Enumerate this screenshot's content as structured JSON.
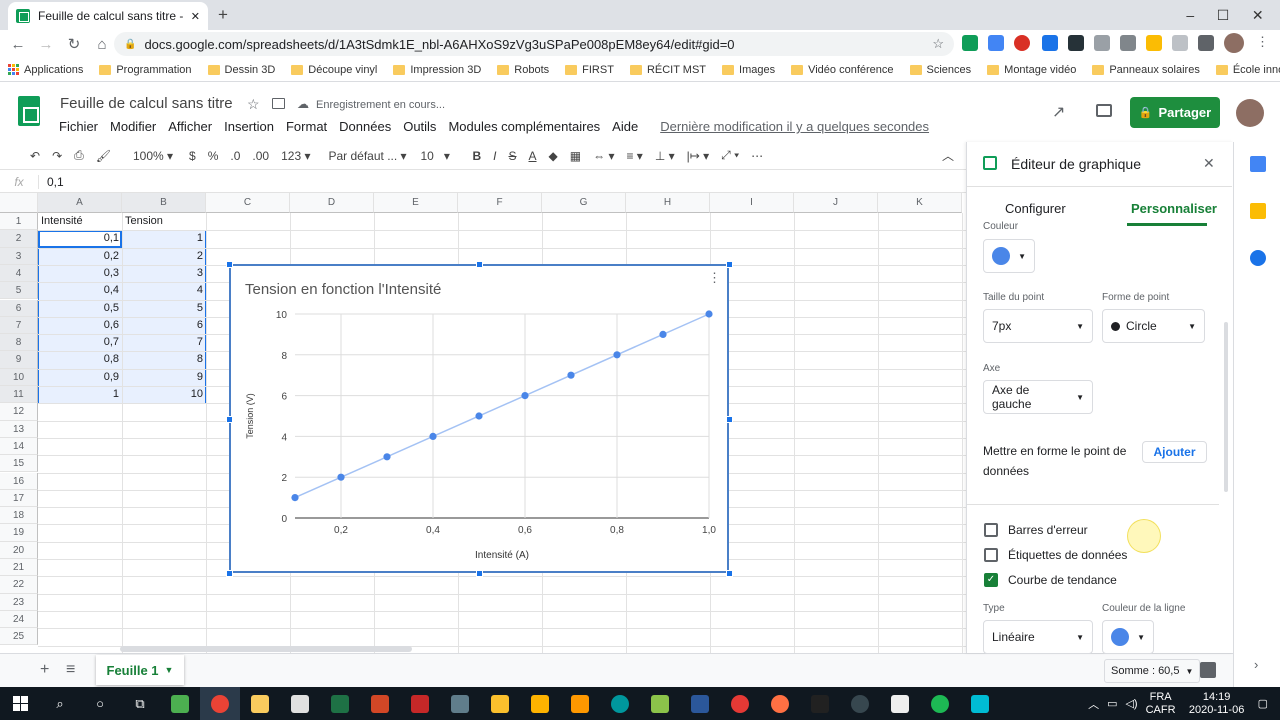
{
  "browser": {
    "tab_title": "Feuille de calcul sans titre - Goog",
    "tab_close": "✕",
    "new_tab": "+",
    "url": "docs.google.com/spreadsheets/d/1A3tSdmk1E_nbl-A6AHXoS9zVg3uSPaPe008pEM8ey64/edit#gid=0",
    "bookmarks": [
      "Applications",
      "Programmation",
      "Dessin 3D",
      "Découpe vinyl",
      "Impression 3D",
      "Robots",
      "FIRST",
      "RÉCIT MST",
      "Images",
      "Vidéo conférence",
      "Sciences",
      "Montage vidéo",
      "Panneaux solaires",
      "École innovante"
    ],
    "bookmarks_more": "»"
  },
  "sheets": {
    "doc_title": "Feuille de calcul sans titre",
    "save_status": "Enregistrement en cours...",
    "menu": [
      "Fichier",
      "Modifier",
      "Afficher",
      "Insertion",
      "Format",
      "Données",
      "Outils",
      "Modules complémentaires",
      "Aide"
    ],
    "last_edit": "Dernière modification il y a quelques secondes",
    "share_label": "Partager"
  },
  "toolbar": {
    "zoom": "100%",
    "currency": "$",
    "percent": "%",
    "dec_less": ".0",
    "dec_more": ".00",
    "format_more": "123",
    "font": "Par défaut ...",
    "size": "10",
    "more": "⋯"
  },
  "formula_bar": {
    "fx": "fx",
    "value": "0,1"
  },
  "grid": {
    "columns": [
      "A",
      "B",
      "C",
      "D",
      "E",
      "F",
      "G",
      "H",
      "I",
      "J",
      "K"
    ],
    "rows": [
      "1",
      "2",
      "3",
      "4",
      "5",
      "6",
      "7",
      "8",
      "9",
      "10",
      "11",
      "12",
      "13",
      "14",
      "15",
      "16",
      "17",
      "18",
      "19",
      "20",
      "21",
      "22",
      "23",
      "24",
      "25"
    ],
    "headers": [
      "Intensité",
      "Tension"
    ],
    "col_a": [
      "0,1",
      "0,2",
      "0,3",
      "0,4",
      "0,5",
      "0,6",
      "0,7",
      "0,8",
      "0,9",
      "1"
    ],
    "col_b": [
      "1",
      "2",
      "3",
      "4",
      "5",
      "6",
      "7",
      "8",
      "9",
      "10"
    ]
  },
  "chart_data": {
    "type": "scatter",
    "title": "Tension en fonction l'Intensité",
    "xlabel": "Intensité (A)",
    "ylabel": "Tension (V)",
    "x": [
      0.1,
      0.2,
      0.3,
      0.4,
      0.5,
      0.6,
      0.7,
      0.8,
      0.9,
      1.0
    ],
    "y": [
      1,
      2,
      3,
      4,
      5,
      6,
      7,
      8,
      9,
      10
    ],
    "xticks": [
      "0,2",
      "0,4",
      "0,6",
      "0,8",
      "1,0"
    ],
    "yticks": [
      "0",
      "2",
      "4",
      "6",
      "8",
      "10"
    ],
    "xlim": [
      0.1,
      1.0
    ],
    "ylim": [
      0,
      10
    ],
    "trendline": "linear",
    "color": "#4a86e8",
    "trend_color": "#a4c2f4",
    "grid": true
  },
  "bottom": {
    "add": "+",
    "list": "≡",
    "sheet_tab": "Feuille 1",
    "sum": "Somme : 60,5"
  },
  "panel": {
    "title": "Éditeur de graphique",
    "tab_config": "Configurer",
    "tab_custom": "Personnaliser",
    "couleur_label": "Couleur",
    "point_size_label": "Taille du point",
    "point_size": "7px",
    "point_shape_label": "Forme de point",
    "point_shape": "Circle",
    "axis_label": "Axe",
    "axis": "Axe de gauche",
    "format_point": "Mettre en forme le point de données",
    "add": "Ajouter",
    "error_bars": "Barres d'erreur",
    "data_labels": "Étiquettes de données",
    "trendline": "Courbe de tendance",
    "type_label": "Type",
    "type": "Linéaire",
    "line_color_label": "Couleur de la ligne",
    "accent": "#1a73e8"
  },
  "taskbar": {
    "lang": "FRA",
    "layout": "CAFR",
    "time": "14:19",
    "date": "2020-11-06"
  }
}
